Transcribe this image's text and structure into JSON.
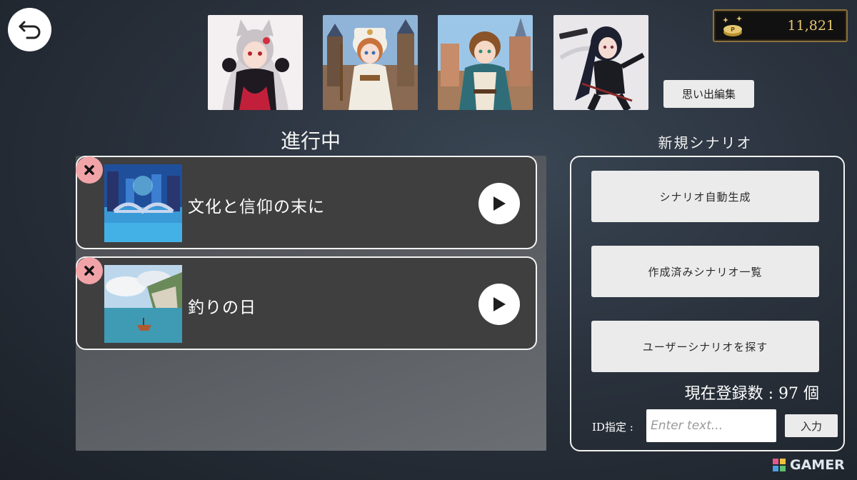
{
  "header": {
    "back_icon": "undo-arrow-icon",
    "memories_button": "思い出編集",
    "coins": {
      "icon": "p-coin-icon",
      "value": "11,821"
    },
    "portraits": [
      {
        "name": "portrait-cat-girl"
      },
      {
        "name": "portrait-priestess"
      },
      {
        "name": "portrait-young-adventurer"
      },
      {
        "name": "portrait-gunslinger"
      }
    ]
  },
  "in_progress": {
    "title": "進行中",
    "items": [
      {
        "title": "文化と信仰の末に",
        "thumb": "fantasy-canal-city"
      },
      {
        "title": "釣りの日",
        "thumb": "seaside-boat"
      }
    ]
  },
  "new_scenario": {
    "title": "新規シナリオ",
    "buttons": {
      "auto_generate": "シナリオ自動生成",
      "created_list": "作成済みシナリオ一覧",
      "search_user": "ユーザーシナリオを探す"
    },
    "registered_count": "現在登録数 : 97 個",
    "id_label": "ID指定 :",
    "id_placeholder": "Enter text...",
    "enter_button": "入力"
  },
  "watermark": {
    "text": "GAMER"
  },
  "colors": {
    "coin_text": "#e6c772",
    "delete_badge": "#f1a4a8",
    "card_bg": "#3f3f40"
  }
}
